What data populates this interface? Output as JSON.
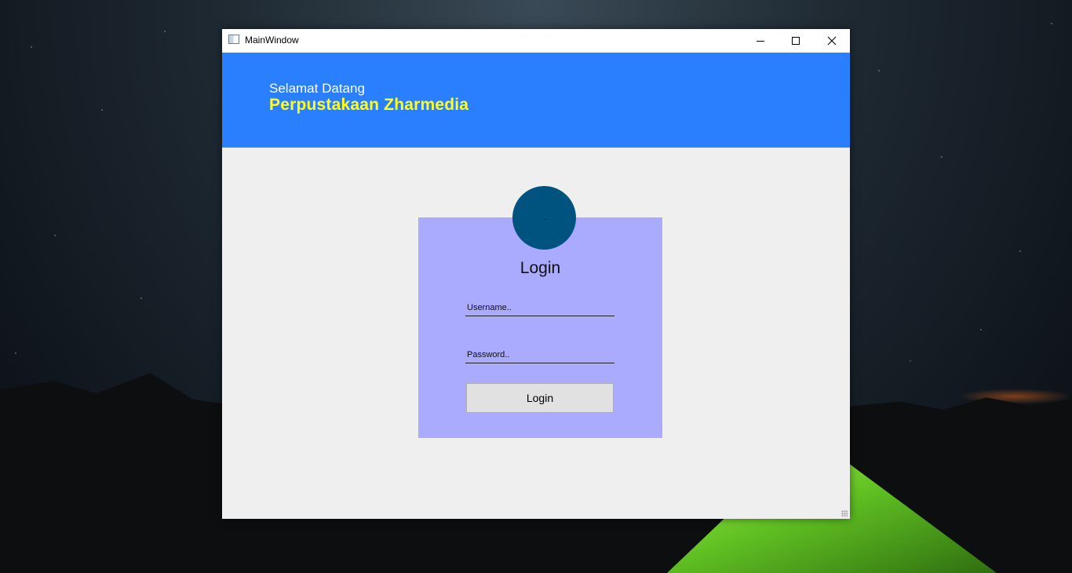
{
  "window": {
    "title": "MainWindow",
    "icons": {
      "app": "app-window-icon",
      "minimize": "minimize-icon",
      "maximize": "maximize-icon",
      "close": "close-icon"
    }
  },
  "header": {
    "welcome_text": "Selamat Datang",
    "library_name": "Perpustakaan Zharmedia",
    "background_color": "#2a7fff",
    "title_color": "#ffff1a"
  },
  "login": {
    "avatar_text": "...",
    "title": "Login",
    "username_placeholder": "Username..",
    "password_placeholder": "Password..",
    "button_label": "Login",
    "card_color": "#aaaaff",
    "avatar_color": "#00527f"
  }
}
